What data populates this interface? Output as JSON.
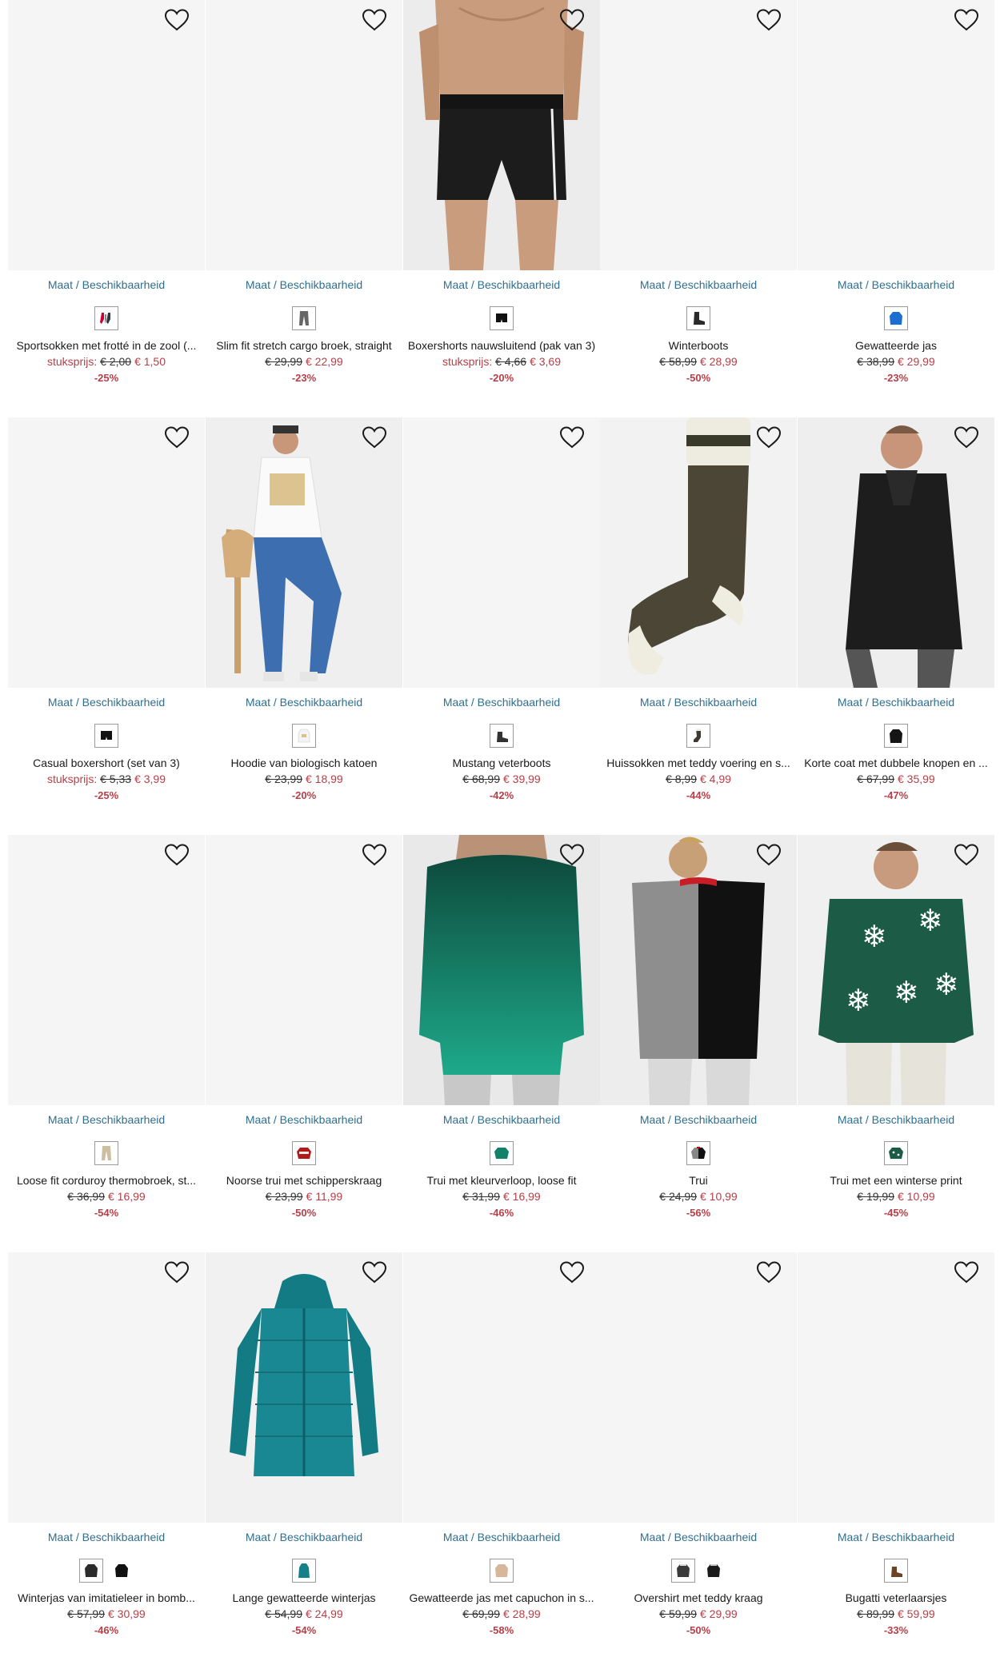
{
  "size_label": "Maat / Beschikbaarheid",
  "products": [
    {
      "title": "Sportsokken met frotté in de zool (...",
      "unit_label": "stuksprijs:",
      "old_price": "€ 2,00",
      "new_price": "€ 1,50",
      "discount": "-25%",
      "photo": "none",
      "swatches": [
        "socks-multi"
      ]
    },
    {
      "title": "Slim fit stretch cargo broek, straight",
      "unit_label": "",
      "old_price": "€ 29,99",
      "new_price": "€ 22,99",
      "discount": "-23%",
      "photo": "none",
      "swatches": [
        "pants-grey"
      ]
    },
    {
      "title": "Boxershorts nauwsluitend (pak van 3)",
      "unit_label": "stuksprijs:",
      "old_price": "€ 4,66",
      "new_price": "€ 3,69",
      "discount": "-20%",
      "photo": "boxer",
      "swatches": [
        "boxer-black"
      ]
    },
    {
      "title": "Winterboots",
      "unit_label": "",
      "old_price": "€ 58,99",
      "new_price": "€ 28,99",
      "discount": "-50%",
      "photo": "none",
      "swatches": [
        "boot-black"
      ]
    },
    {
      "title": "Gewatteerde jas",
      "unit_label": "",
      "old_price": "€ 38,99",
      "new_price": "€ 29,99",
      "discount": "-23%",
      "photo": "none",
      "swatches": [
        "jacket-blue"
      ]
    },
    {
      "title": "Casual boxershort (set van 3)",
      "unit_label": "stuksprijs:",
      "old_price": "€ 5,33",
      "new_price": "€ 3,99",
      "discount": "-25%",
      "photo": "none",
      "swatches": [
        "boxer-black"
      ]
    },
    {
      "title": "Hoodie van biologisch katoen",
      "unit_label": "",
      "old_price": "€ 23,99",
      "new_price": "€ 18,99",
      "discount": "-20%",
      "photo": "hoodie",
      "swatches": [
        "hoodie-white"
      ]
    },
    {
      "title": "Mustang veterboots",
      "unit_label": "",
      "old_price": "€ 68,99",
      "new_price": "€ 39,99",
      "discount": "-42%",
      "photo": "none",
      "swatches": [
        "boot-dark"
      ]
    },
    {
      "title": "Huissokken met teddy voering en s...",
      "unit_label": "",
      "old_price": "€ 8,99",
      "new_price": "€ 4,99",
      "discount": "-44%",
      "photo": "sock",
      "swatches": [
        "sock-dark"
      ]
    },
    {
      "title": "Korte coat met dubbele knopen en ...",
      "unit_label": "",
      "old_price": "€ 67,99",
      "new_price": "€ 35,99",
      "discount": "-47%",
      "photo": "coat",
      "swatches": [
        "coat-black"
      ]
    },
    {
      "title": "Loose fit corduroy thermobroek, st...",
      "unit_label": "",
      "old_price": "€ 36,99",
      "new_price": "€ 16,99",
      "discount": "-54%",
      "photo": "none",
      "swatches": [
        "pants-beige"
      ]
    },
    {
      "title": "Noorse trui met schipperskraag",
      "unit_label": "",
      "old_price": "€ 23,99",
      "new_price": "€ 11,99",
      "discount": "-50%",
      "photo": "none",
      "swatches": [
        "sweater-red"
      ]
    },
    {
      "title": "Trui met kleurverloop, loose fit",
      "unit_label": "",
      "old_price": "€ 31,99",
      "new_price": "€ 16,99",
      "discount": "-46%",
      "photo": "greensweater",
      "swatches": [
        "sweater-green"
      ]
    },
    {
      "title": "Trui",
      "unit_label": "",
      "old_price": "€ 24,99",
      "new_price": "€ 10,99",
      "discount": "-56%",
      "photo": "splitsweater",
      "swatches": [
        "sweater-split"
      ]
    },
    {
      "title": "Trui met een winterse print",
      "unit_label": "",
      "old_price": "€ 19,99",
      "new_price": "€ 10,99",
      "discount": "-45%",
      "photo": "snowsweater",
      "swatches": [
        "sweater-snow"
      ]
    },
    {
      "title": "Winterjas van imitatieleer in bomb...",
      "unit_label": "",
      "old_price": "€ 57,99",
      "new_price": "€ 30,99",
      "discount": "-46%",
      "photo": "none",
      "swatches": [
        "jacket-dark",
        "jacket-black-plain"
      ]
    },
    {
      "title": "Lange gewatteerde winterjas",
      "unit_label": "",
      "old_price": "€ 54,99",
      "new_price": "€ 24,99",
      "discount": "-54%",
      "photo": "parka",
      "swatches": [
        "parka-teal"
      ]
    },
    {
      "title": "Gewatteerde jas met capuchon in s...",
      "unit_label": "",
      "old_price": "€ 69,99",
      "new_price": "€ 28,99",
      "discount": "-58%",
      "photo": "none",
      "swatches": [
        "jacket-beige"
      ]
    },
    {
      "title": "Overshirt met teddy kraag",
      "unit_label": "",
      "old_price": "€ 59,99",
      "new_price": "€ 29,99",
      "discount": "-50%",
      "photo": "none",
      "swatches": [
        "shirt-dark",
        "shirt-black-plain"
      ]
    },
    {
      "title": "Bugatti veterlaarsjes",
      "unit_label": "",
      "old_price": "€ 89,99",
      "new_price": "€ 59,99",
      "discount": "-33%",
      "photo": "none",
      "swatches": [
        "boot-brown"
      ]
    }
  ]
}
